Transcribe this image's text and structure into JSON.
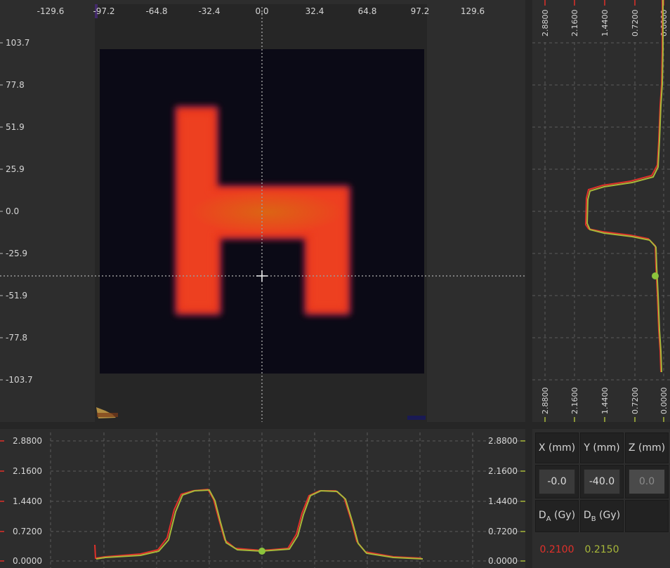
{
  "main_view": {
    "x_ticks": [
      "-129.6",
      "-97.2",
      "-64.8",
      "-32.4",
      "0.0",
      "32.4",
      "64.8",
      "97.2",
      "129.6"
    ],
    "y_ticks": [
      "103.7",
      "77.8",
      "51.9",
      "25.9",
      "0.0",
      "-25.9",
      "-51.9",
      "-77.8",
      "-103.7"
    ],
    "crosshair_mm": {
      "x": 0.0,
      "y": -40.0
    }
  },
  "side_profile": {
    "dose_ticks": [
      "2.8800",
      "2.1600",
      "1.4400",
      "0.7200",
      "0.0000"
    ]
  },
  "bottom_profile": {
    "left_ticks": [
      "2.8800",
      "2.1600",
      "1.4400",
      "0.7200",
      "0.0000"
    ],
    "right_ticks": [
      "2.8800",
      "2.1600",
      "1.4400",
      "0.7200",
      "0.0000"
    ]
  },
  "info_panel": {
    "x_label": "X (mm)",
    "y_label": "Y (mm)",
    "z_label": "Z (mm)",
    "x_value": "-0.0",
    "y_value": "-40.0",
    "z_value": "0.0",
    "da_label_main": "D",
    "da_label_sub": "A",
    "da_label_unit": " (Gy)",
    "db_label_main": "D",
    "db_label_sub": "B",
    "db_label_unit": " (Gy)",
    "da_value": "0.2100",
    "db_value": "0.2150"
  },
  "colors": {
    "series_a": "#e0302a",
    "series_b": "#a8b83a",
    "marker": "#8cc43c",
    "grid": "#5a5a5a"
  }
}
